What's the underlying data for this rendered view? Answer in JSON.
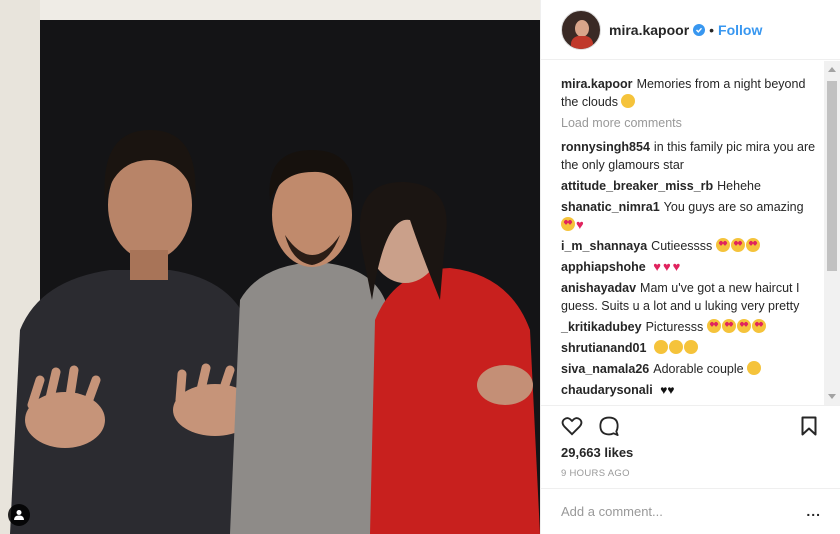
{
  "post": {
    "username": "mira.kapoor",
    "follow_label": "Follow",
    "dot": "•",
    "photo_alt": "Group photo"
  },
  "caption": {
    "username": "mira.kapoor",
    "text": "Memories from a night beyond the clouds"
  },
  "load_more_label": "Load more comments",
  "comments": [
    {
      "user": "ronnysingh854",
      "text": "in this family pic mira you are the only glamours star"
    },
    {
      "user": "attitude_breaker_miss_rb",
      "text": "Hehehe"
    },
    {
      "user": "shanatic_nimra1",
      "text": "You guys are so amazing"
    },
    {
      "user": "i_m_shannaya",
      "text": "Cutieessss"
    },
    {
      "user": "apphiapshohe",
      "text": ""
    },
    {
      "user": "anishayadav",
      "text": "Mam u've got a new haircut I guess. Suits u a lot and u luking very pretty"
    },
    {
      "user": "_kritikadubey",
      "text": "Picturesss"
    },
    {
      "user": "shrutianand01",
      "text": ""
    },
    {
      "user": "siva_namala26",
      "text": "Adorable couple"
    },
    {
      "user": "chaudarysonali",
      "text": ""
    }
  ],
  "likes": "29,663 likes",
  "timestamp": "9 HOURS AGO",
  "add_comment_placeholder": "Add a comment...",
  "more_label": "...",
  "colors": {
    "accent": "#3897f0",
    "heart": "#e0245e",
    "muted": "#999999"
  },
  "icons": [
    "tag-user-icon",
    "heart-icon",
    "comment-icon",
    "bookmark-icon",
    "verified-icon"
  ]
}
